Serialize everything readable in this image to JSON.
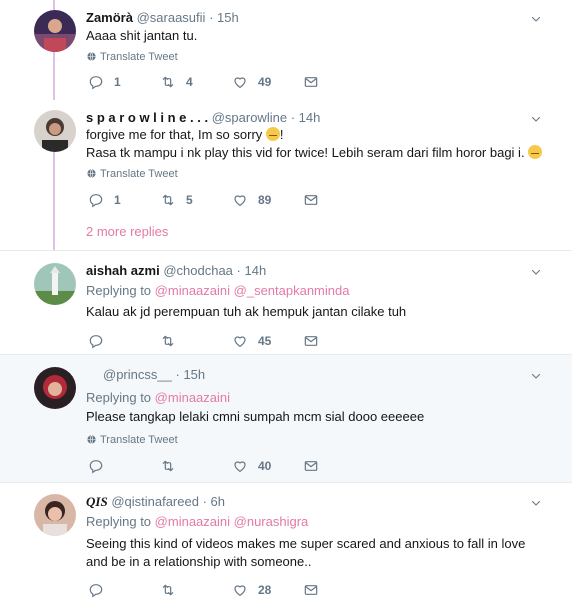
{
  "icons": {
    "reply": "reply-icon",
    "retweet": "retweet-icon",
    "like": "heart-icon",
    "dm": "envelope-icon",
    "caret": "chevron-down-icon",
    "globe": "globe-icon"
  },
  "colors": {
    "link": "#e47aa5",
    "muted": "#657786",
    "thread_line": "#e0c0e8",
    "shaded_bg": "#f5f8fa"
  },
  "tweets": [
    {
      "name": "Zamörà",
      "handle": "@saraasufii",
      "time": "15h",
      "text": "Aaaa shit jantan tu.",
      "translate": "Translate Tweet",
      "replies": "1",
      "retweets": "4",
      "likes": "49"
    },
    {
      "name": "s p a r o w l i n e . . .",
      "handle": "@sparowline",
      "time": "14h",
      "text_line1": "forgive me for that, Im so sorry",
      "text_line1_end": "!",
      "text_line2": "Rasa tk mampu i nk play this vid for twice! Lebih seram dari film horor bagi i.",
      "translate": "Translate Tweet",
      "replies": "1",
      "retweets": "5",
      "likes": "89"
    },
    {
      "more_replies": "2 more replies"
    },
    {
      "name": "aishah azmi",
      "handle": "@chodchaa",
      "time": "14h",
      "replying_to": "Replying to",
      "mention1": "@minaazaini",
      "mention2": "@_sentapkanminda",
      "text": "Kalau ak jd perempuan tuh ak hempuk jantan cilake tuh",
      "replies": "",
      "retweets": "",
      "likes": "45"
    },
    {
      "name": "",
      "handle": "@princss__",
      "time": "15h",
      "replying_to": "Replying to",
      "mention1": "@minaazaini",
      "text": "Please tangkap lelaki cmni sumpah mcm sial dooo eeeeee",
      "translate": "Translate Tweet",
      "replies": "",
      "retweets": "",
      "likes": "40"
    },
    {
      "name": "QIS",
      "handle": "@qistinafareed",
      "time": "6h",
      "replying_to": "Replying to",
      "mention1": "@minaazaini",
      "mention2": "@nurashigra",
      "text": "Seeing this kind of videos makes me super scared and anxious to fall in love and be in a relationship with someone..",
      "replies": "",
      "retweets": "",
      "likes": "28"
    }
  ],
  "separator": "·"
}
